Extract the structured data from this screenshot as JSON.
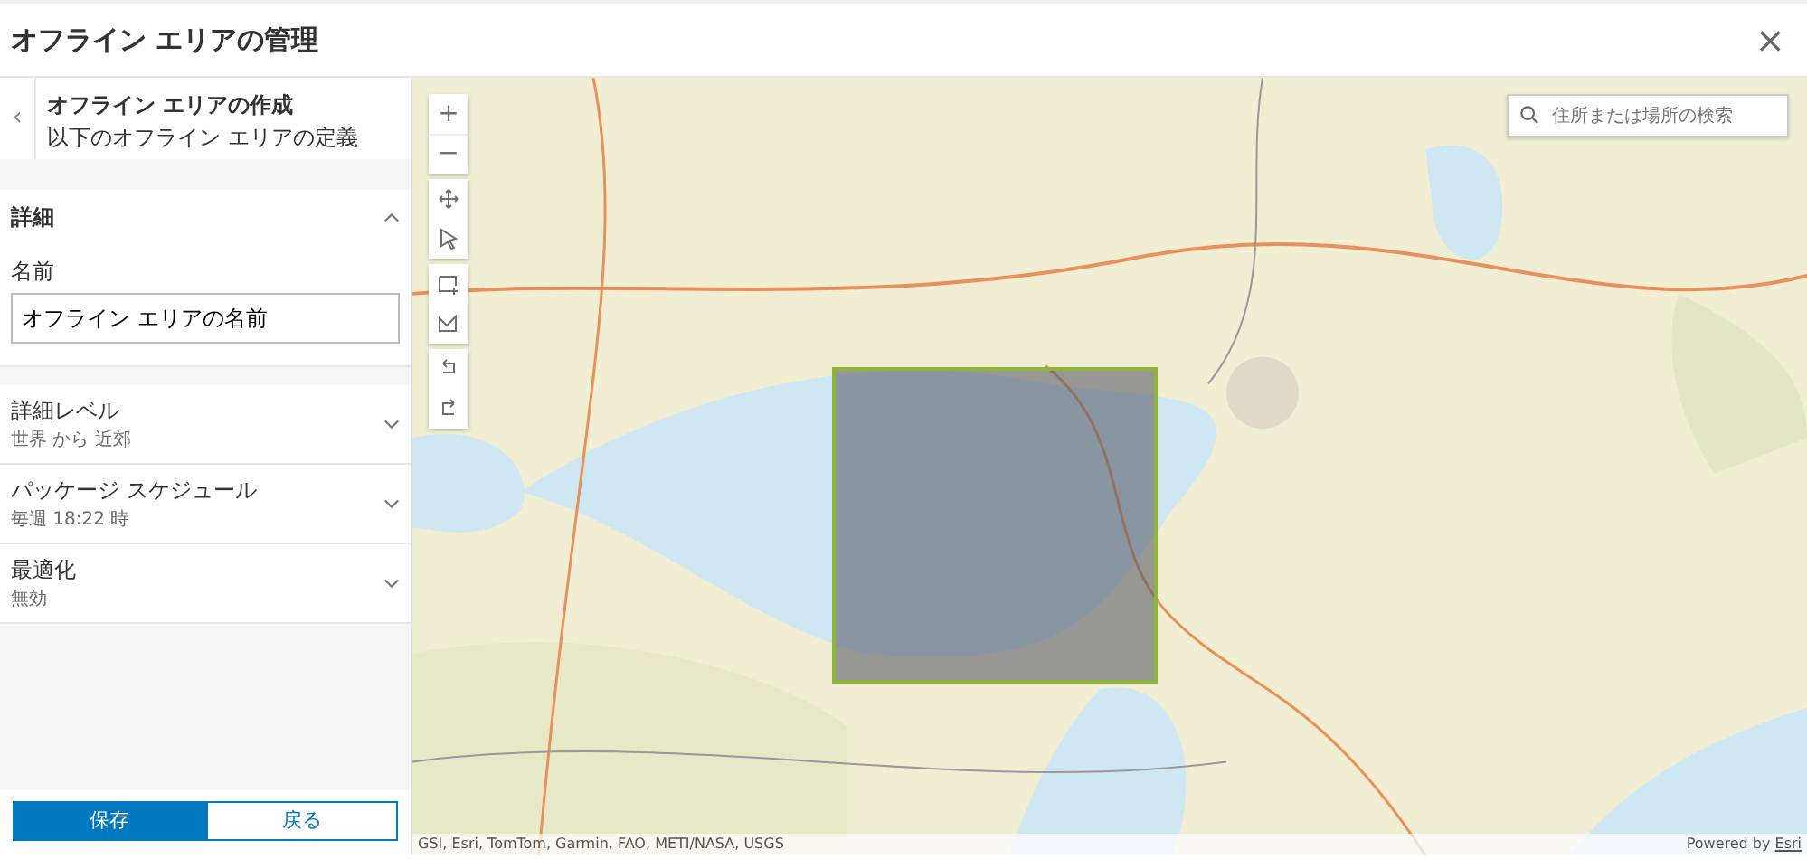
{
  "window": {
    "title": "オフライン エリアの管理",
    "close": "×"
  },
  "panel": {
    "back": "‹",
    "title": "オフライン エリアの作成",
    "subtitle": "以下のオフライン エリアの定義",
    "sections": [
      {
        "title": "詳細",
        "expanded": true,
        "field_label": "名前",
        "field_value": "オフライン エリアの名前"
      },
      {
        "title": "詳細レベル",
        "value": "世界 から 近郊",
        "expanded": false
      },
      {
        "title": "パッケージ スケジュール",
        "value": "毎週 18:22 時",
        "expanded": false
      },
      {
        "title": "最適化",
        "value": "無効",
        "expanded": false
      }
    ],
    "buttons": [
      {
        "label": "保存",
        "kind": "primary"
      },
      {
        "label": "戻る",
        "kind": "secondary"
      }
    ]
  },
  "map": {
    "kind": "picture",
    "zoom": [
      "+",
      "−"
    ],
    "tools": [
      {
        "kind": "move"
      },
      {
        "kind": "select"
      },
      {
        "kind": "rectangle"
      },
      {
        "kind": "polygon"
      },
      {
        "kind": "undo"
      },
      {
        "kind": "redo"
      }
    ],
    "search": {
      "placeholder": "住所または場所の検索"
    },
    "attribution": "GSI, Esri, TomTom, Garmin, FAO, METI/NASA, USGS",
    "powered_by": "Powered by ",
    "powered_link": "Esri"
  }
}
